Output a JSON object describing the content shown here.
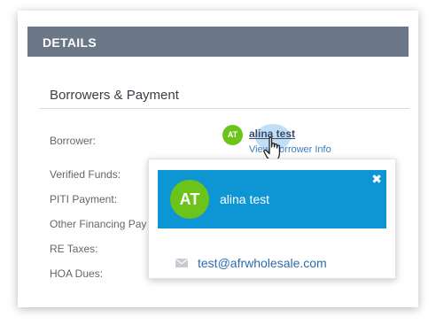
{
  "header": {
    "title": "DETAILS"
  },
  "section": {
    "title": "Borrowers & Payment"
  },
  "fields": {
    "borrower": "Borrower:",
    "verified_funds": "Verified Funds:",
    "piti_payment": "PITI Payment:",
    "other_financing": "Other Financing Pay",
    "re_taxes": "RE Taxes:",
    "hoa_dues": "HOA Dues:"
  },
  "borrower": {
    "initials": "AT",
    "name": "alina test",
    "link_text": "View Borrower Info"
  },
  "popover": {
    "initials": "AT",
    "name": "alina test",
    "close_glyph": "✖",
    "email": "test@afrwholesale.com"
  },
  "colors": {
    "header_bg": "#6b7686",
    "avatar_green": "#6cc319",
    "popover_blue": "#0e95d4",
    "link_blue": "#3d7bbf"
  },
  "icons": [
    "mouse-cursor-hand-icon",
    "close-icon",
    "mail-icon"
  ]
}
